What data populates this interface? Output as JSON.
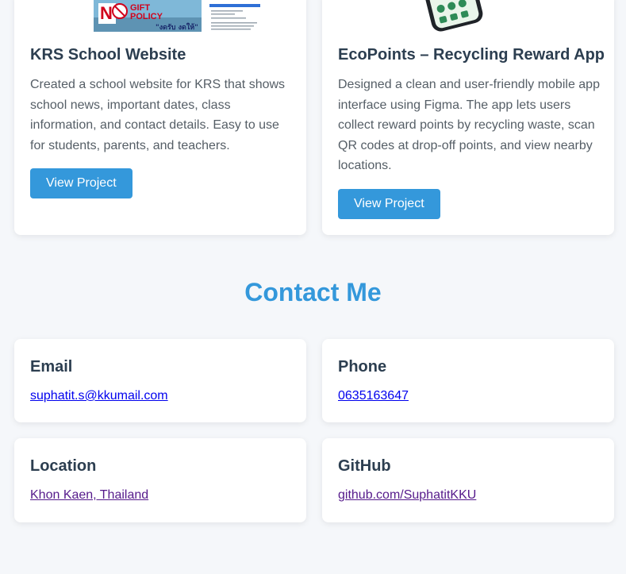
{
  "projects": [
    {
      "title": "KRS School Website",
      "description": "Created a school website for KRS that shows school news, important dates, class information, and contact details. Easy to use for students, parents, and teachers.",
      "button_label": "View Project",
      "thumbnail": {
        "poster_lines": [
          "GIFT",
          "POLICY"
        ],
        "poster_footer": "\"งดรับ งดให้\""
      }
    },
    {
      "title": "EcoPoints – Recycling Reward App",
      "description": "Designed a clean and user-friendly mobile app interface using Figma. The app lets users collect reward points by recycling waste, scan QR codes at drop-off points, and view nearby locations.",
      "button_label": "View Project"
    }
  ],
  "contact": {
    "heading": "Contact Me",
    "items": [
      {
        "label": "Email",
        "value": "suphatit.s@kkumail.com"
      },
      {
        "label": "Phone",
        "value": "0635163647"
      },
      {
        "label": "Location",
        "value": "Khon Kaen, Thailand"
      },
      {
        "label": "GitHub",
        "value": "github.com/SuphatitKKU"
      }
    ]
  },
  "colors": {
    "accent": "#3498db",
    "page_bg": "#f5f7fa",
    "text_dark": "#2c3e50",
    "link_unvisited": "#0000ee",
    "link_visited": "#551a8b"
  }
}
